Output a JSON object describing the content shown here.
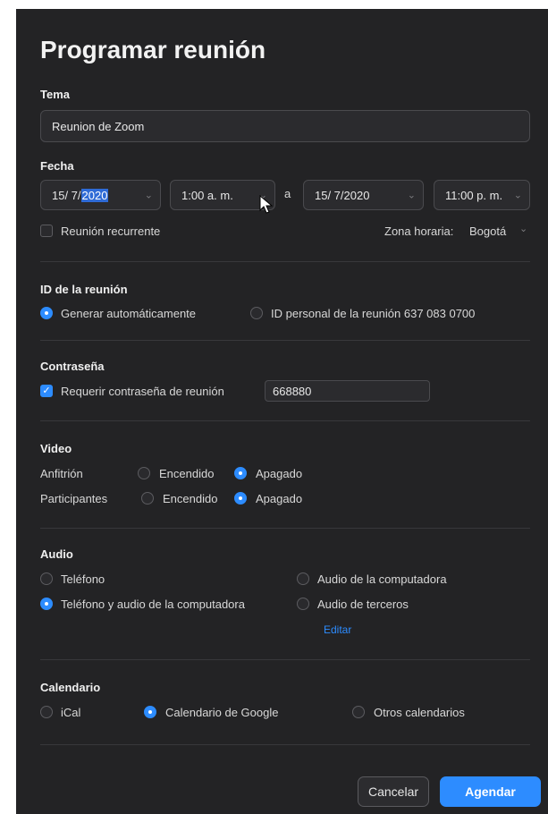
{
  "title": "Programar reunión",
  "topic": {
    "label": "Tema",
    "value": "Reunion de Zoom"
  },
  "date": {
    "label": "Fecha",
    "start_date_prefix": "15/ 7/",
    "start_date_highlight": "2020",
    "start_time": "1:00 a. m.",
    "to": "a",
    "end_date": "15/ 7/2020",
    "end_time": "11:00 p. m."
  },
  "recurring": {
    "label": "Reunión recurrente",
    "checked": false
  },
  "timezone": {
    "label": "Zona horaria:",
    "value": "Bogotá"
  },
  "meeting_id": {
    "label": "ID de la reunión",
    "auto": "Generar automáticamente",
    "personal": "ID personal de la reunión 637 083 0700"
  },
  "password": {
    "label": "Contraseña",
    "require": "Requerir contraseña de reunión",
    "value": "668880"
  },
  "video": {
    "label": "Video",
    "host": "Anfitrión",
    "participants": "Participantes",
    "on": "Encendido",
    "off": "Apagado"
  },
  "audio": {
    "label": "Audio",
    "phone": "Teléfono",
    "computer": "Audio de la computadora",
    "both": "Teléfono y audio de la computadora",
    "third_party": "Audio de terceros",
    "edit": "Editar"
  },
  "calendar": {
    "label": "Calendario",
    "ical": "iCal",
    "google": "Calendario de Google",
    "other": "Otros calendarios"
  },
  "buttons": {
    "cancel": "Cancelar",
    "schedule": "Agendar"
  },
  "colors": {
    "background": "#232325",
    "accent": "#2d8cff"
  }
}
